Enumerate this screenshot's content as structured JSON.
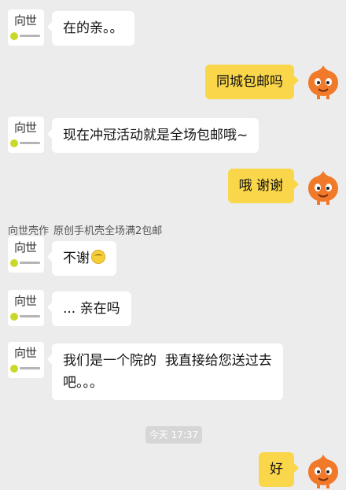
{
  "shop": {
    "logo_text": "向世",
    "name": "向世壳作",
    "subtitle": "原创手机壳全场满2包邮"
  },
  "messages": [
    {
      "side": "left",
      "text": "在的亲。。"
    },
    {
      "side": "right",
      "text": "同城包邮吗"
    },
    {
      "side": "left",
      "text": "现在冲冠活动就是全场包邮哦~"
    },
    {
      "side": "right",
      "text": "哦 谢谢"
    },
    {
      "side": "left",
      "text": "不谢",
      "emoji": "smile-emoji"
    },
    {
      "side": "left",
      "text": "... 亲在吗"
    },
    {
      "side": "left",
      "text_line1": "我们是一个院的  我直接给您送过去",
      "text_line2": "吧。。。"
    },
    {
      "side": "right",
      "text": "好"
    }
  ],
  "timestamp": "今天 17:37",
  "colors": {
    "background": "#ececec",
    "incoming_bubble": "#ffffff",
    "outgoing_bubble": "#fad64a",
    "logo_dot": "#c9d92a",
    "user_avatar": "#f07a2a"
  }
}
